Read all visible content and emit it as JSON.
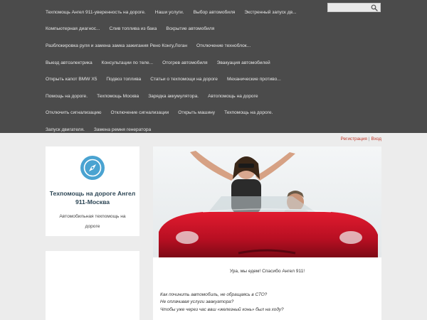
{
  "nav": {
    "rows": [
      [
        "Техпомощь Ангел 911-уверенность на дороге.",
        "Наши услуги.",
        "Выбор автомобиля",
        "Экстренный запуск дв..."
      ],
      [
        "Компьютерная диагнос...",
        "Слив топлива из бака",
        "Вскрытие автомобиля"
      ],
      [
        "Разблокировка руля и замена замка зажигания Рено Конгу,Логан",
        "Отключение техноблок..."
      ],
      [
        "Выезд автоэлектрика",
        "Консультации по теле...",
        "Отогрев автомобиля",
        "Эвакуация автомобилей"
      ],
      [
        "Открыть капот BMW X5",
        "Подвоз топлива",
        "Статьи о техпомощи на дороге",
        "Механические противо..."
      ],
      [
        "Помощь на дороге.",
        "Техпомощь Москва",
        "Зарядка аккумулятора.",
        "Автопомощь на дороге"
      ],
      [
        "Отключить сигнализацию",
        "Отключение сигнализации",
        "Открыть машину",
        "Техпомощь на дороге."
      ],
      [
        "Запуск двигателя.",
        "Замена ремня генератора"
      ]
    ]
  },
  "search": {
    "placeholder": "",
    "icon": "search-icon"
  },
  "auth": {
    "register": "Регистрация",
    "separator": "|",
    "login": "Вход"
  },
  "brand": {
    "icon": "compass-icon",
    "title": "Техпомощь на дороге Ангел 911-Москва",
    "description": "Автомобильная техпомощь на дороге"
  },
  "main": {
    "caption": "Ура, мы едем! Спасибо Ангел 911!",
    "intro": [
      "Как починить автомобиль, не обращаясь в СТО?",
      "Не оплачивая услуги эвакуатора?",
      "Чтобы уже через час ваш «железный конь» был на ходу?"
    ]
  },
  "colors": {
    "nav_bg": "#4b4b4b",
    "page_bg": "#ececec",
    "link_accent": "#c0392b",
    "brand_icon": "#4aa3d1",
    "car_red": "#c8102e"
  }
}
